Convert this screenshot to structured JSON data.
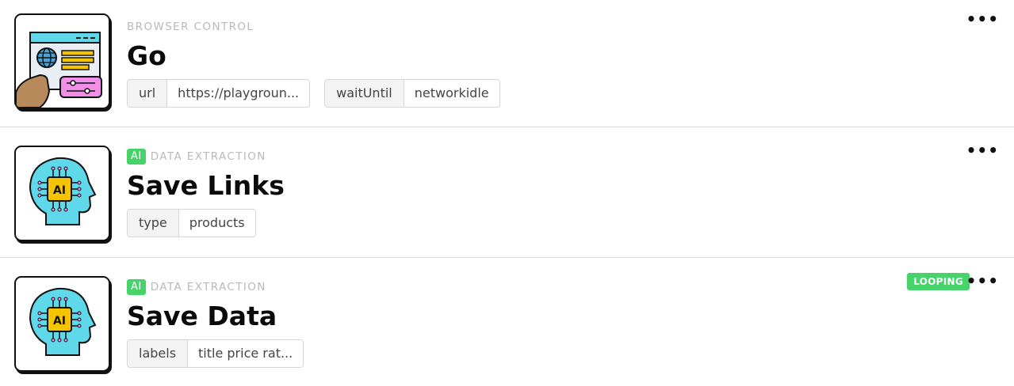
{
  "steps": [
    {
      "icon": "browser-window-icon",
      "ai_badge": "",
      "category": "BROWSER CONTROL",
      "title": "Go",
      "params": [
        {
          "key": "url",
          "value": "https://playgroun..."
        },
        {
          "key": "waitUntil",
          "value": "networkidle"
        }
      ],
      "menu": "•••",
      "status": ""
    },
    {
      "icon": "ai-head-icon",
      "ai_badge": "AI",
      "category": "DATA EXTRACTION",
      "title": "Save Links",
      "params": [
        {
          "key": "type",
          "value": "products"
        }
      ],
      "menu": "•••",
      "status": ""
    },
    {
      "icon": "ai-head-icon",
      "ai_badge": "AI",
      "category": "DATA EXTRACTION",
      "title": "Save Data",
      "params": [
        {
          "key": "labels",
          "value": "title price rat..."
        }
      ],
      "menu": "•••",
      "status": "LOOPING"
    }
  ],
  "colors": {
    "ai_green": "#45d36a",
    "head_cyan": "#5fd9ea",
    "chip_yellow": "#f5c400",
    "pink": "#f08ee8"
  }
}
